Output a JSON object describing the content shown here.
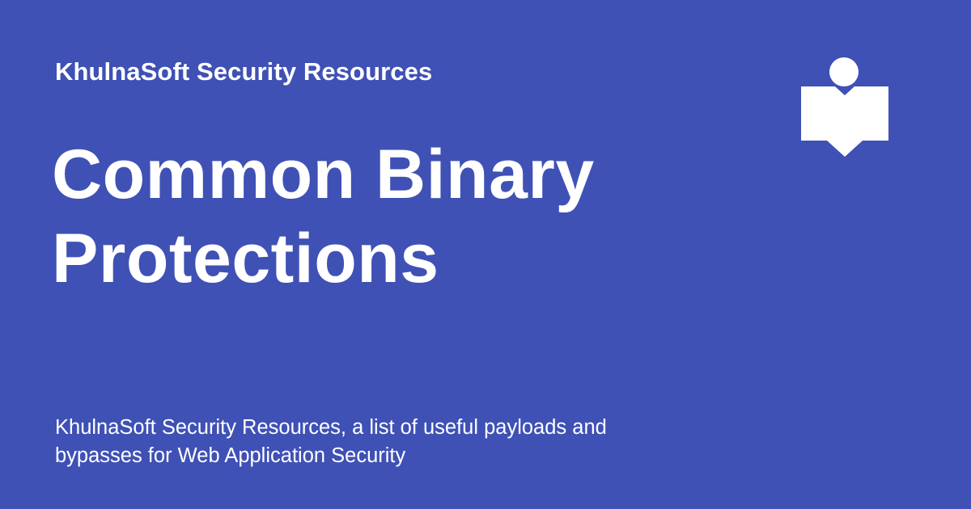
{
  "header": {
    "site_name": "KhulnaSoft Security Resources"
  },
  "main": {
    "title_lines": [
      "Common Binary",
      "Protections"
    ],
    "description_lines": [
      "KhulnaSoft Security Resources, a list of useful payloads and",
      "bypasses for Web Application Security"
    ]
  },
  "logo": {
    "icon": "reader-book-icon"
  },
  "colors": {
    "background": "#3f51b5",
    "text": "#ffffff"
  }
}
